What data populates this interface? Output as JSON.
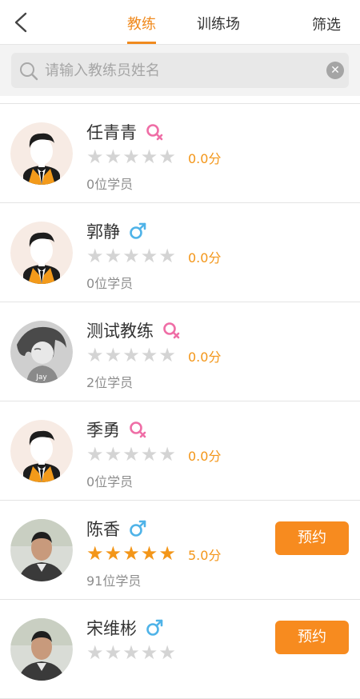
{
  "nav": {
    "tabs": [
      "教练",
      "训练场"
    ],
    "filter_label": "筛选",
    "accent": "#f08a1e"
  },
  "search": {
    "placeholder": "请输入教练员姓名",
    "value": ""
  },
  "coaches": [
    {
      "name": "任青青",
      "gender": "female",
      "rating": 0,
      "score": "0.0分",
      "students": "0位学员",
      "avatar": "default-avatar",
      "book_label": ""
    },
    {
      "name": "郭静",
      "gender": "male",
      "rating": 0,
      "score": "0.0分",
      "students": "0位学员",
      "avatar": "default-avatar",
      "book_label": ""
    },
    {
      "name": "测试教练",
      "gender": "female",
      "rating": 0,
      "score": "0.0分",
      "students": "2位学员",
      "avatar": "sketch-photo",
      "avatar_text": "Jay",
      "book_label": ""
    },
    {
      "name": "季勇",
      "gender": "female",
      "rating": 0,
      "score": "0.0分",
      "students": "0位学员",
      "avatar": "default-avatar",
      "book_label": ""
    },
    {
      "name": "陈香",
      "gender": "male",
      "rating": 5,
      "score": "5.0分",
      "students": "91位学员",
      "avatar": "person-photo",
      "book_label": "预约"
    },
    {
      "name": "宋维彬",
      "gender": "male",
      "rating": 0,
      "score": "",
      "students": "",
      "avatar": "person-photo",
      "book_label": "预约"
    }
  ],
  "colors": {
    "female": "#ef6ea6",
    "male": "#4fb3e8",
    "star_on": "#f39619",
    "star_off": "#d4d4d4",
    "button": "#f78b1f"
  }
}
